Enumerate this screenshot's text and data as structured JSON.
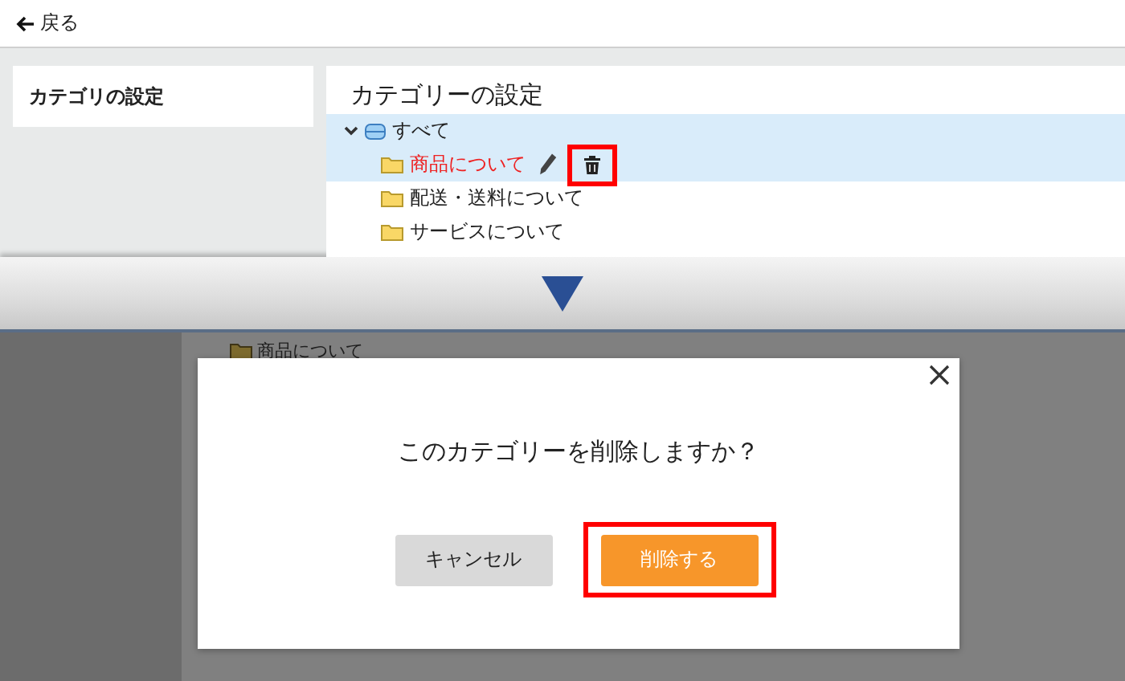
{
  "top_screen": {
    "back_link": "戻る",
    "sidebar": {
      "title": "カテゴリの設定"
    },
    "main": {
      "title": "カテゴリーの設定",
      "tree": [
        {
          "label": "すべて",
          "expanded": true,
          "selected": true,
          "children": [
            {
              "label": "商品について",
              "selected": false,
              "hovered": true,
              "delete_highlighted": true
            },
            {
              "label": "配送・送料について",
              "selected": false,
              "hovered": false
            },
            {
              "label": "サービスについて",
              "selected": false,
              "hovered": false
            }
          ]
        }
      ]
    }
  },
  "dialog_screen": {
    "background_item": "商品について",
    "dialog": {
      "message": "このカテゴリーを削除しますか？",
      "buttons": [
        {
          "label": "キャンセル",
          "kind": "cancel",
          "highlighted": false
        },
        {
          "label": "削除する",
          "kind": "confirm",
          "highlighted": true
        }
      ]
    }
  }
}
